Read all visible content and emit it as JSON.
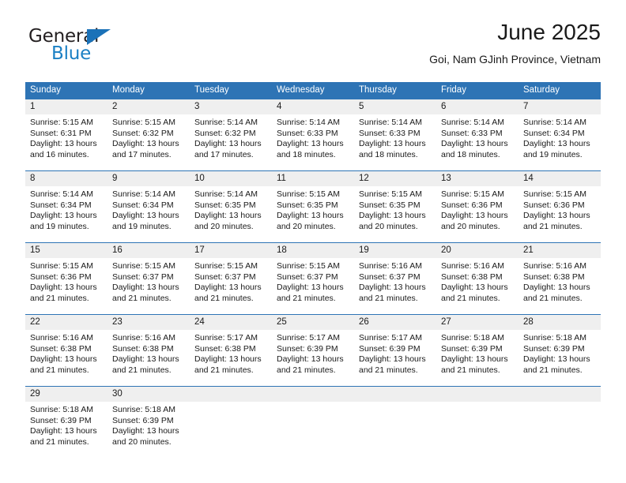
{
  "brand": {
    "name_top": "General",
    "name_bottom": "Blue",
    "color_dark": "#231f20",
    "color_blue": "#1b80c4"
  },
  "header": {
    "title": "June 2025",
    "subtitle": "Goi, Nam GJinh Province, Vietnam"
  },
  "theme": {
    "header_blue": "#2e74b5",
    "day_band_gray": "#efefef",
    "text": "#1a1a1a"
  },
  "weekdays": [
    "Sunday",
    "Monday",
    "Tuesday",
    "Wednesday",
    "Thursday",
    "Friday",
    "Saturday"
  ],
  "weeks": [
    [
      {
        "day": "1",
        "sunrise": "Sunrise: 5:15 AM",
        "sunset": "Sunset: 6:31 PM",
        "daylight_1": "Daylight: 13 hours",
        "daylight_2": "and 16 minutes."
      },
      {
        "day": "2",
        "sunrise": "Sunrise: 5:15 AM",
        "sunset": "Sunset: 6:32 PM",
        "daylight_1": "Daylight: 13 hours",
        "daylight_2": "and 17 minutes."
      },
      {
        "day": "3",
        "sunrise": "Sunrise: 5:14 AM",
        "sunset": "Sunset: 6:32 PM",
        "daylight_1": "Daylight: 13 hours",
        "daylight_2": "and 17 minutes."
      },
      {
        "day": "4",
        "sunrise": "Sunrise: 5:14 AM",
        "sunset": "Sunset: 6:33 PM",
        "daylight_1": "Daylight: 13 hours",
        "daylight_2": "and 18 minutes."
      },
      {
        "day": "5",
        "sunrise": "Sunrise: 5:14 AM",
        "sunset": "Sunset: 6:33 PM",
        "daylight_1": "Daylight: 13 hours",
        "daylight_2": "and 18 minutes."
      },
      {
        "day": "6",
        "sunrise": "Sunrise: 5:14 AM",
        "sunset": "Sunset: 6:33 PM",
        "daylight_1": "Daylight: 13 hours",
        "daylight_2": "and 18 minutes."
      },
      {
        "day": "7",
        "sunrise": "Sunrise: 5:14 AM",
        "sunset": "Sunset: 6:34 PM",
        "daylight_1": "Daylight: 13 hours",
        "daylight_2": "and 19 minutes."
      }
    ],
    [
      {
        "day": "8",
        "sunrise": "Sunrise: 5:14 AM",
        "sunset": "Sunset: 6:34 PM",
        "daylight_1": "Daylight: 13 hours",
        "daylight_2": "and 19 minutes."
      },
      {
        "day": "9",
        "sunrise": "Sunrise: 5:14 AM",
        "sunset": "Sunset: 6:34 PM",
        "daylight_1": "Daylight: 13 hours",
        "daylight_2": "and 19 minutes."
      },
      {
        "day": "10",
        "sunrise": "Sunrise: 5:14 AM",
        "sunset": "Sunset: 6:35 PM",
        "daylight_1": "Daylight: 13 hours",
        "daylight_2": "and 20 minutes."
      },
      {
        "day": "11",
        "sunrise": "Sunrise: 5:15 AM",
        "sunset": "Sunset: 6:35 PM",
        "daylight_1": "Daylight: 13 hours",
        "daylight_2": "and 20 minutes."
      },
      {
        "day": "12",
        "sunrise": "Sunrise: 5:15 AM",
        "sunset": "Sunset: 6:35 PM",
        "daylight_1": "Daylight: 13 hours",
        "daylight_2": "and 20 minutes."
      },
      {
        "day": "13",
        "sunrise": "Sunrise: 5:15 AM",
        "sunset": "Sunset: 6:36 PM",
        "daylight_1": "Daylight: 13 hours",
        "daylight_2": "and 20 minutes."
      },
      {
        "day": "14",
        "sunrise": "Sunrise: 5:15 AM",
        "sunset": "Sunset: 6:36 PM",
        "daylight_1": "Daylight: 13 hours",
        "daylight_2": "and 21 minutes."
      }
    ],
    [
      {
        "day": "15",
        "sunrise": "Sunrise: 5:15 AM",
        "sunset": "Sunset: 6:36 PM",
        "daylight_1": "Daylight: 13 hours",
        "daylight_2": "and 21 minutes."
      },
      {
        "day": "16",
        "sunrise": "Sunrise: 5:15 AM",
        "sunset": "Sunset: 6:37 PM",
        "daylight_1": "Daylight: 13 hours",
        "daylight_2": "and 21 minutes."
      },
      {
        "day": "17",
        "sunrise": "Sunrise: 5:15 AM",
        "sunset": "Sunset: 6:37 PM",
        "daylight_1": "Daylight: 13 hours",
        "daylight_2": "and 21 minutes."
      },
      {
        "day": "18",
        "sunrise": "Sunrise: 5:15 AM",
        "sunset": "Sunset: 6:37 PM",
        "daylight_1": "Daylight: 13 hours",
        "daylight_2": "and 21 minutes."
      },
      {
        "day": "19",
        "sunrise": "Sunrise: 5:16 AM",
        "sunset": "Sunset: 6:37 PM",
        "daylight_1": "Daylight: 13 hours",
        "daylight_2": "and 21 minutes."
      },
      {
        "day": "20",
        "sunrise": "Sunrise: 5:16 AM",
        "sunset": "Sunset: 6:38 PM",
        "daylight_1": "Daylight: 13 hours",
        "daylight_2": "and 21 minutes."
      },
      {
        "day": "21",
        "sunrise": "Sunrise: 5:16 AM",
        "sunset": "Sunset: 6:38 PM",
        "daylight_1": "Daylight: 13 hours",
        "daylight_2": "and 21 minutes."
      }
    ],
    [
      {
        "day": "22",
        "sunrise": "Sunrise: 5:16 AM",
        "sunset": "Sunset: 6:38 PM",
        "daylight_1": "Daylight: 13 hours",
        "daylight_2": "and 21 minutes."
      },
      {
        "day": "23",
        "sunrise": "Sunrise: 5:16 AM",
        "sunset": "Sunset: 6:38 PM",
        "daylight_1": "Daylight: 13 hours",
        "daylight_2": "and 21 minutes."
      },
      {
        "day": "24",
        "sunrise": "Sunrise: 5:17 AM",
        "sunset": "Sunset: 6:38 PM",
        "daylight_1": "Daylight: 13 hours",
        "daylight_2": "and 21 minutes."
      },
      {
        "day": "25",
        "sunrise": "Sunrise: 5:17 AM",
        "sunset": "Sunset: 6:39 PM",
        "daylight_1": "Daylight: 13 hours",
        "daylight_2": "and 21 minutes."
      },
      {
        "day": "26",
        "sunrise": "Sunrise: 5:17 AM",
        "sunset": "Sunset: 6:39 PM",
        "daylight_1": "Daylight: 13 hours",
        "daylight_2": "and 21 minutes."
      },
      {
        "day": "27",
        "sunrise": "Sunrise: 5:18 AM",
        "sunset": "Sunset: 6:39 PM",
        "daylight_1": "Daylight: 13 hours",
        "daylight_2": "and 21 minutes."
      },
      {
        "day": "28",
        "sunrise": "Sunrise: 5:18 AM",
        "sunset": "Sunset: 6:39 PM",
        "daylight_1": "Daylight: 13 hours",
        "daylight_2": "and 21 minutes."
      }
    ],
    [
      {
        "day": "29",
        "sunrise": "Sunrise: 5:18 AM",
        "sunset": "Sunset: 6:39 PM",
        "daylight_1": "Daylight: 13 hours",
        "daylight_2": "and 21 minutes."
      },
      {
        "day": "30",
        "sunrise": "Sunrise: 5:18 AM",
        "sunset": "Sunset: 6:39 PM",
        "daylight_1": "Daylight: 13 hours",
        "daylight_2": "and 20 minutes."
      },
      {
        "day": "",
        "sunrise": "",
        "sunset": "",
        "daylight_1": "",
        "daylight_2": ""
      },
      {
        "day": "",
        "sunrise": "",
        "sunset": "",
        "daylight_1": "",
        "daylight_2": ""
      },
      {
        "day": "",
        "sunrise": "",
        "sunset": "",
        "daylight_1": "",
        "daylight_2": ""
      },
      {
        "day": "",
        "sunrise": "",
        "sunset": "",
        "daylight_1": "",
        "daylight_2": ""
      },
      {
        "day": "",
        "sunrise": "",
        "sunset": "",
        "daylight_1": "",
        "daylight_2": ""
      }
    ]
  ]
}
